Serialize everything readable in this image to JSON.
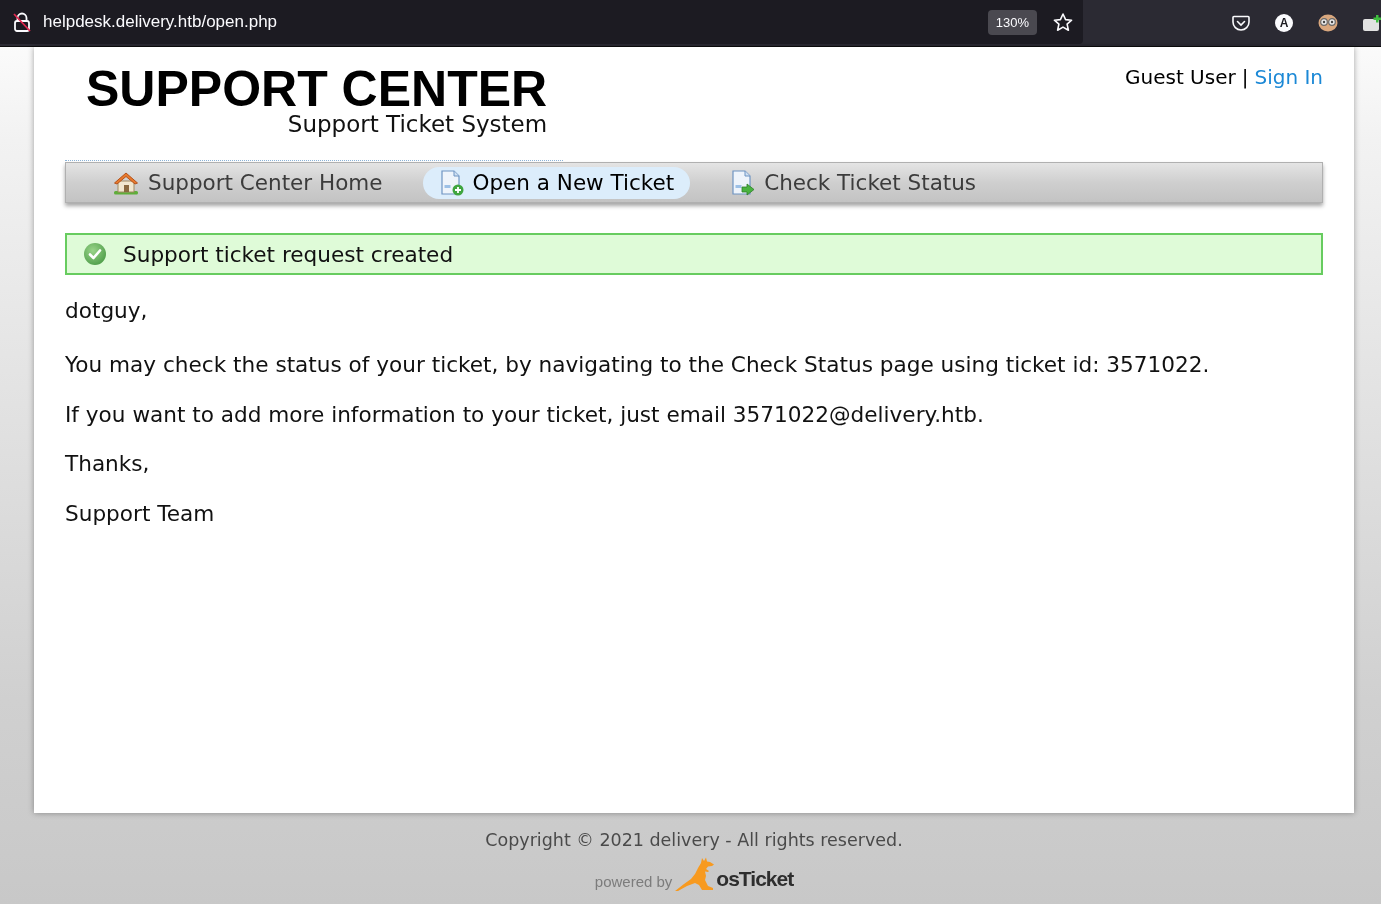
{
  "browser": {
    "url": "helpdesk.delivery.htb/open.php",
    "zoom": "130%",
    "account_initial": "A"
  },
  "header": {
    "title": "SUPPORT CENTER",
    "subtitle": "Support Ticket System",
    "user": "Guest User",
    "separator": "|",
    "sign_in": "Sign In"
  },
  "nav": [
    {
      "label": "Support Center Home",
      "kind": "home",
      "selected": false
    },
    {
      "label": "Open a New Ticket",
      "kind": "new",
      "selected": true
    },
    {
      "label": "Check Ticket Status",
      "kind": "status",
      "selected": false
    }
  ],
  "alert": {
    "kind": "success",
    "text": "Support ticket request created"
  },
  "message": {
    "greeting": "dotguy,",
    "paragraphs": [
      "You may check the status of your ticket, by navigating to the Check Status page using ticket id: 3571022.",
      "If you want to add more information to your ticket, just email 3571022@delivery.htb.",
      "Thanks,",
      "Support Team"
    ]
  },
  "footer": {
    "copyright": "Copyright © 2021 delivery - All rights reserved.",
    "powered_by": "powered by",
    "brand": "osTicket"
  }
}
